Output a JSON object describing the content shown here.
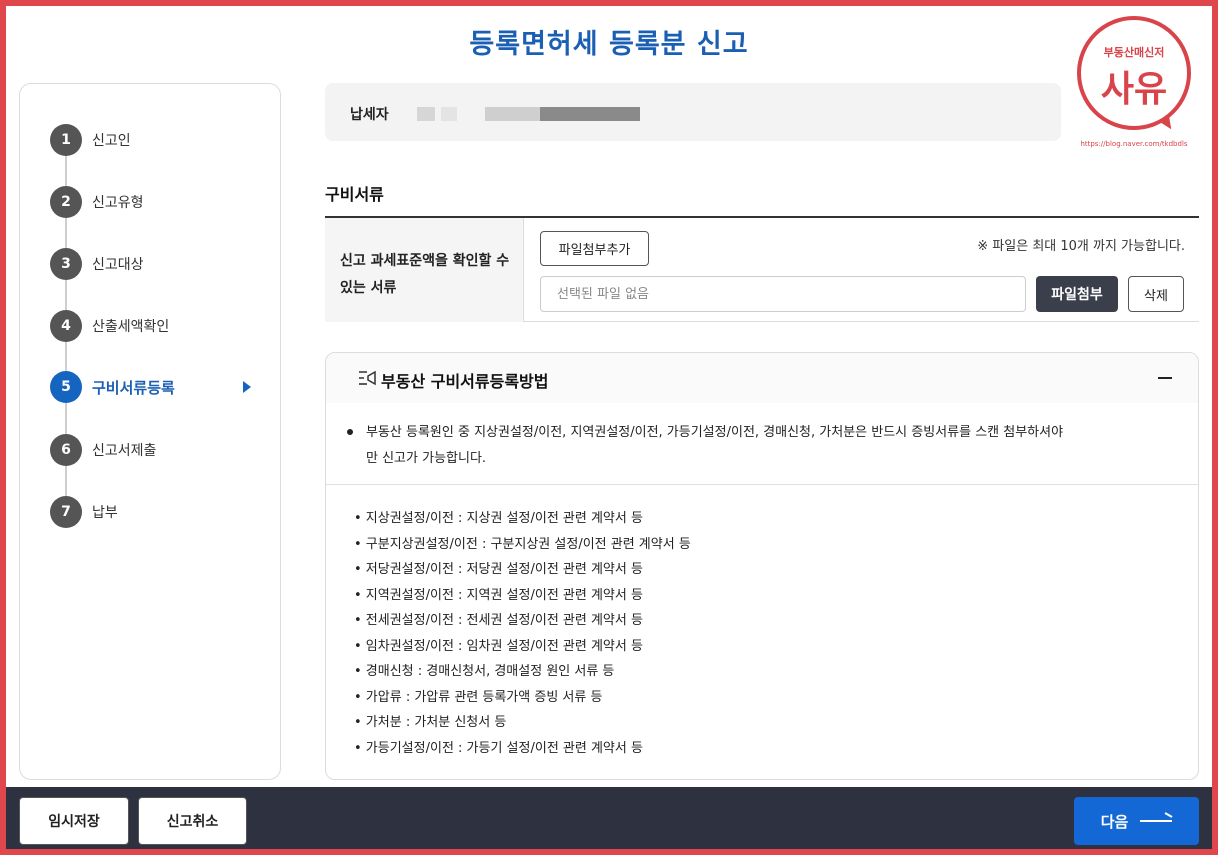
{
  "page": {
    "title": "등록면허세 등록분 신고"
  },
  "stamp": {
    "top_text": "부동산매신저",
    "main_text": "사유",
    "url": "https://blog.naver.com/tkdbdls"
  },
  "sidebar": {
    "steps": [
      {
        "num": "1",
        "label": "신고인"
      },
      {
        "num": "2",
        "label": "신고유형"
      },
      {
        "num": "3",
        "label": "신고대상"
      },
      {
        "num": "4",
        "label": "산출세액확인"
      },
      {
        "num": "5",
        "label": "구비서류등록",
        "active": true
      },
      {
        "num": "6",
        "label": "신고서제출"
      },
      {
        "num": "7",
        "label": "납부"
      }
    ]
  },
  "taxpayer": {
    "label": "납세자"
  },
  "documents": {
    "section_title": "구비서류",
    "row_label": "신고 과세표준액을 확인할 수 있는 서류",
    "add_file_button": "파일첨부추가",
    "file_limit_note": "※ 파일은 최대 10개 까지 가능합니다.",
    "file_placeholder": "선택된 파일 없음",
    "attach_button": "파일첨부",
    "delete_button": "삭제"
  },
  "guide": {
    "title": "부동산 구비서류등록방법",
    "note": "부동산 등록원인 중 지상권설정/이전, 지역권설정/이전, 가등기설정/이전, 경매신청, 가처분은 반드시 증빙서류를 스캔 첨부하셔야만 신고가 가능합니다.",
    "items": [
      "• 지상권설정/이전 : 지상권 설정/이전 관련 계약서 등",
      "• 구분지상권설정/이전 : 구분지상권 설정/이전 관련 계약서 등",
      "• 저당권설정/이전 : 저당권 설정/이전 관련 계약서 등",
      "• 지역권설정/이전 : 지역권 설정/이전 관련 계약서 등",
      "• 전세권설정/이전 : 전세권 설정/이전 관련 계약서 등",
      "• 임차권설정/이전 : 임차권 설정/이전 관련 계약서 등",
      "• 경매신청 : 경매신청서, 경매설정 원인 서류 등",
      "• 가압류 : 가압류 관련 등록가액 증빙 서류 등",
      "• 가처분 : 가처분 신청서 등",
      "• 가등기설정/이전 : 가등기 설정/이전 관련 계약서 등"
    ]
  },
  "footer": {
    "save_button": "임시저장",
    "cancel_button": "신고취소",
    "next_button": "다음"
  },
  "colors": {
    "accent": "#1565c0",
    "dark_bar": "#2e3240",
    "frame": "#e0474c"
  }
}
